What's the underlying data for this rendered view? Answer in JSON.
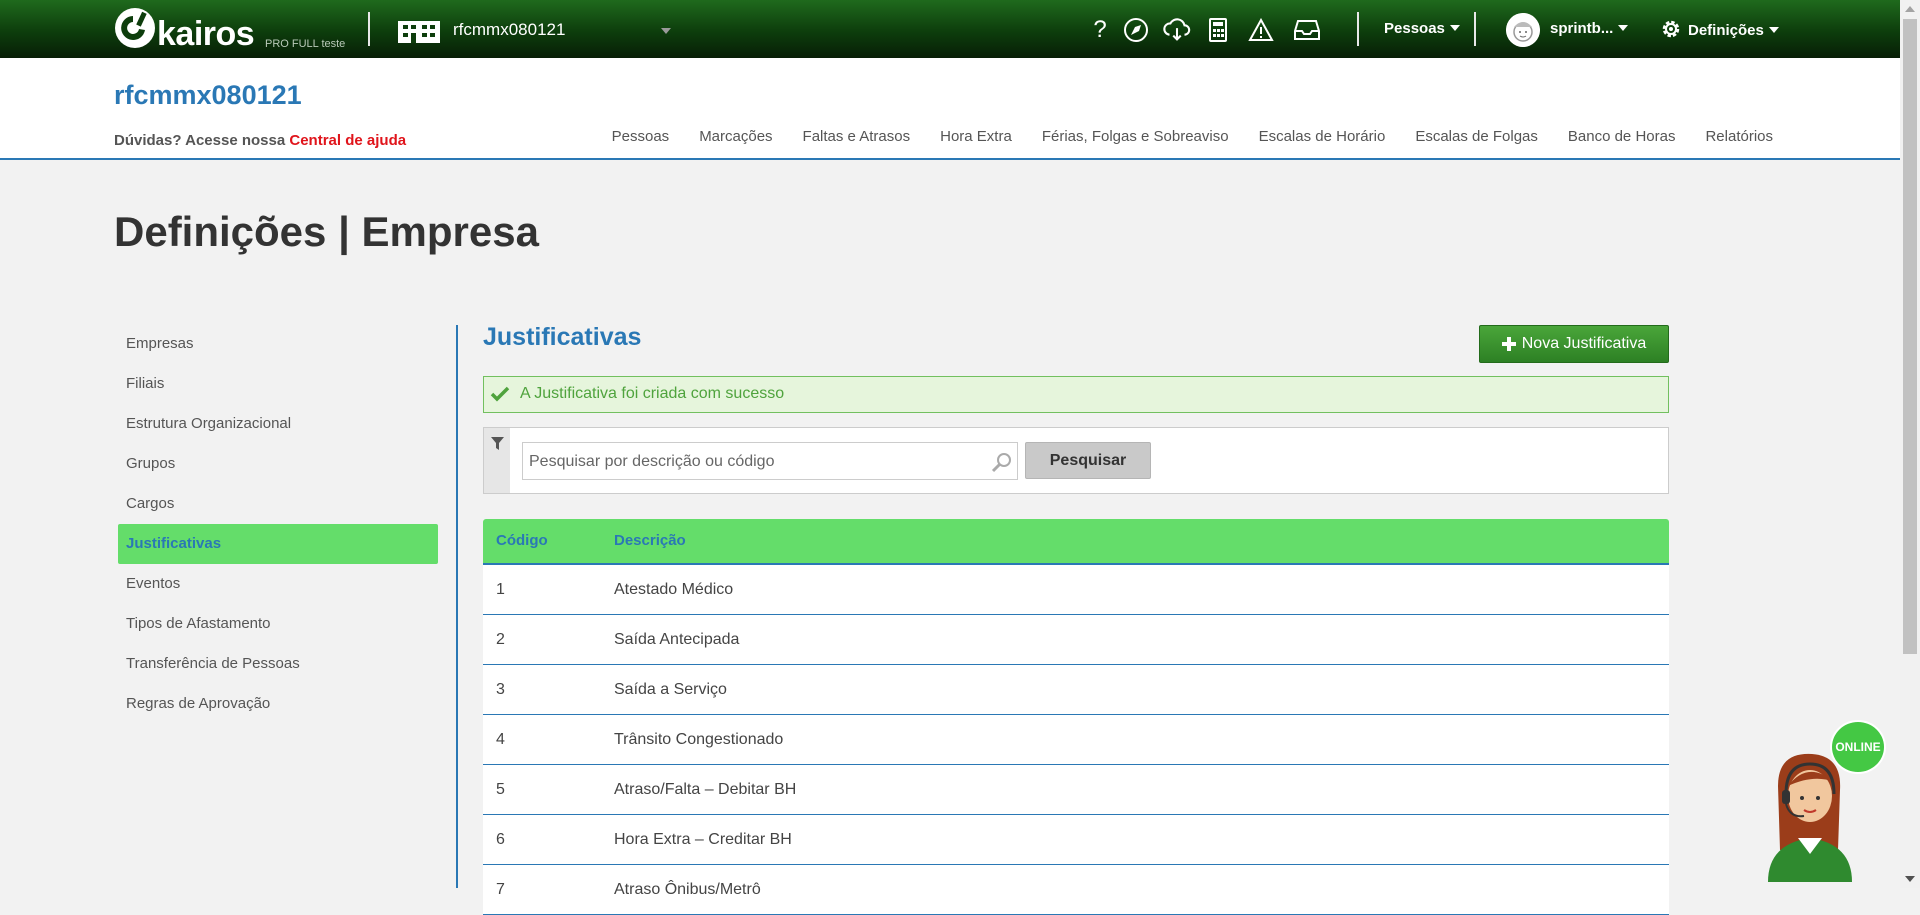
{
  "topbar": {
    "brand": "kairos",
    "brand_tag": "PRO FULL teste",
    "company": "rfcmmx080121",
    "icons": [
      "help-icon",
      "rocket-icon",
      "cloud-download-icon",
      "calculator-icon",
      "warning-icon",
      "inbox-icon"
    ],
    "people_menu": "Pessoas",
    "user_menu": "sprintb...",
    "settings_menu": "Definições"
  },
  "header": {
    "company_title": "rfcmmx080121",
    "help_text": "Dúvidas? Acesse nossa",
    "help_link": "Central de ajuda",
    "nav": [
      "Pessoas",
      "Marcações",
      "Faltas e Atrasos",
      "Hora Extra",
      "Férias, Folgas e Sobreaviso",
      "Escalas de Horário",
      "Escalas de Folgas",
      "Banco de Horas",
      "Relatórios"
    ]
  },
  "page": {
    "title": "Definições | Empresa"
  },
  "sidebar": {
    "items": [
      {
        "label": "Empresas"
      },
      {
        "label": "Filiais"
      },
      {
        "label": "Estrutura Organizacional"
      },
      {
        "label": "Grupos"
      },
      {
        "label": "Cargos"
      },
      {
        "label": "Justificativas"
      },
      {
        "label": "Eventos"
      },
      {
        "label": "Tipos de Afastamento"
      },
      {
        "label": "Transferência de Pessoas"
      },
      {
        "label": "Regras de Aprovação"
      }
    ],
    "active_index": 5
  },
  "content": {
    "section_title": "Justificativas",
    "new_button": "Nova Justificativa",
    "alert": "A Justificativa foi criada com sucesso",
    "search": {
      "placeholder": "Pesquisar por descrição ou código",
      "value": "",
      "button": "Pesquisar"
    },
    "table": {
      "columns": [
        "Código",
        "Descrição"
      ],
      "rows": [
        {
          "code": "1",
          "desc": "Atestado Médico"
        },
        {
          "code": "2",
          "desc": "Saída Antecipada"
        },
        {
          "code": "3",
          "desc": "Saída a Serviço"
        },
        {
          "code": "4",
          "desc": "Trânsito Congestionado"
        },
        {
          "code": "5",
          "desc": "Atraso/Falta – Debitar BH"
        },
        {
          "code": "6",
          "desc": "Hora Extra – Creditar BH"
        },
        {
          "code": "7",
          "desc": "Atraso Ônibus/Metrô"
        }
      ]
    }
  },
  "chat": {
    "status": "ONLINE"
  },
  "colors": {
    "accent": "#2a78b5",
    "highlight": "#64dd6a",
    "button_green": "#3a9a2e",
    "link_red": "#e0141b"
  }
}
